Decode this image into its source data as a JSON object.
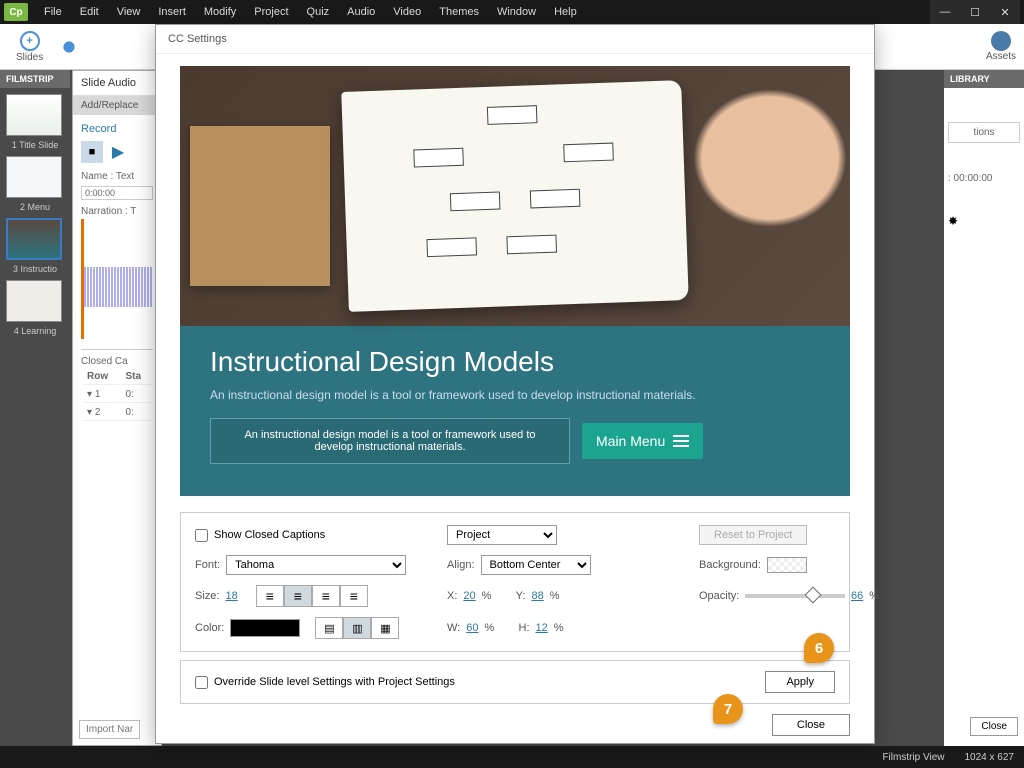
{
  "app": {
    "logo": "Cp"
  },
  "menu": [
    "File",
    "Edit",
    "View",
    "Insert",
    "Modify",
    "Project",
    "Quiz",
    "Audio",
    "Video",
    "Themes",
    "Window",
    "Help"
  ],
  "toolbar": {
    "slides": "Slides",
    "assets": "Assets"
  },
  "filmstrip": {
    "header": "FILMSTRIP",
    "items": [
      {
        "label": "1 Title Slide"
      },
      {
        "label": "2 Menu"
      },
      {
        "label": "3 Instructio"
      },
      {
        "label": "4 Learning"
      }
    ]
  },
  "slideAudio": {
    "title": "Slide Audio",
    "tab": "Add/Replace",
    "record": "Record",
    "name": "Name : Text",
    "time": "0:00:00",
    "narration": "Narration : T",
    "closedCap": "Closed Ca",
    "cols": {
      "row": "Row",
      "sta": "Sta"
    },
    "rows": [
      {
        "n": "1",
        "t": "0:"
      },
      {
        "n": "2",
        "t": "0:"
      }
    ],
    "importBtn": "Import Nar"
  },
  "dialog": {
    "title": "CC Settings",
    "preview": {
      "heading": "Instructional Design Models",
      "subtitle": "An instructional design model is a tool or framework used to develop instructional materials.",
      "caption": "An instructional design model is a tool or framework used to develop instructional materials.",
      "mainMenu": "Main Menu"
    },
    "settings": {
      "showCC": "Show Closed Captions",
      "projectSel": "Project",
      "reset": "Reset to Project",
      "fontLbl": "Font:",
      "font": "Tahoma",
      "alignLbl": "Align:",
      "align": "Bottom Center",
      "bgLbl": "Background:",
      "sizeLbl": "Size:",
      "size": "18",
      "xLbl": "X:",
      "x": "20",
      "yLbl": "Y:",
      "y": "88",
      "pct": "%",
      "opacityLbl": "Opacity:",
      "opacity": "66",
      "colorLbl": "Color:",
      "wLbl": "W:",
      "w": "60",
      "hLbl": "H:",
      "h": "12",
      "override": "Override Slide level Settings with Project Settings",
      "apply": "Apply",
      "close": "Close"
    }
  },
  "right": {
    "library": "LIBRARY",
    "tions": "tions",
    "time": ": 00:00:00",
    "closeBtn": "Close"
  },
  "status": {
    "view": "Filmstrip View",
    "dims": "1024 x 627"
  },
  "callouts": {
    "c6": "6",
    "c7": "7"
  }
}
